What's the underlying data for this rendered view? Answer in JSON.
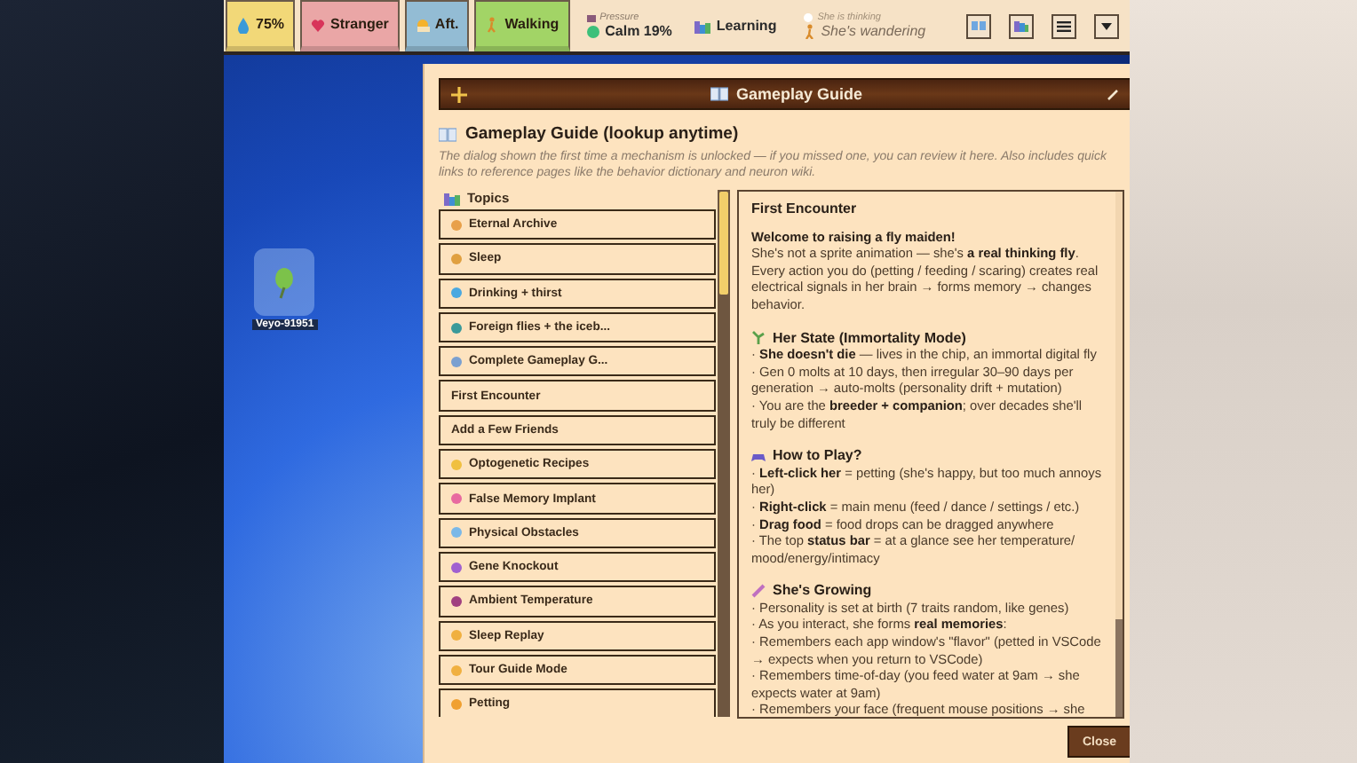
{
  "status_bar": {
    "chips": [
      {
        "label": "75%",
        "color": "#f2d878"
      },
      {
        "label": "Stranger",
        "color": "#eaa6a6"
      },
      {
        "label": "Aft.",
        "color": "#93bcd4"
      },
      {
        "label": "Walking",
        "color": "#a2d466"
      }
    ],
    "pressure": {
      "caption": "Pressure",
      "value": "Calm 19%"
    },
    "learning": "Learning",
    "thinking": {
      "caption": "She is thinking",
      "value": "She's wandering"
    }
  },
  "desktop_icon": {
    "label": "Veyo-91951"
  },
  "dialog": {
    "title": "Gameplay Guide",
    "heading": "Gameplay Guide (lookup anytime)",
    "description": "The dialog shown the first time a mechanism is unlocked — if you missed one, you can review it here. Also includes quick links to reference pages like the behavior dictionary and neuron wiki.",
    "topics_label": "Topics",
    "topics": [
      {
        "label": "Eternal Archive",
        "has_icon": true
      },
      {
        "label": "Sleep",
        "has_icon": true
      },
      {
        "label": "Drinking + thirst",
        "has_icon": true
      },
      {
        "label": "Foreign flies + the iceb...",
        "has_icon": true
      },
      {
        "label": "Complete Gameplay G...",
        "has_icon": true
      },
      {
        "label": "First Encounter",
        "has_icon": false
      },
      {
        "label": "Add a Few Friends",
        "has_icon": false
      },
      {
        "label": "Optogenetic Recipes",
        "has_icon": true
      },
      {
        "label": "False Memory Implant",
        "has_icon": true
      },
      {
        "label": "Physical Obstacles",
        "has_icon": true
      },
      {
        "label": "Gene Knockout",
        "has_icon": true
      },
      {
        "label": "Ambient Temperature",
        "has_icon": true
      },
      {
        "label": "Sleep Replay",
        "has_icon": true
      },
      {
        "label": "Tour Guide Mode",
        "has_icon": true
      },
      {
        "label": "Petting",
        "has_icon": true
      }
    ],
    "article": {
      "title": "First Encounter",
      "sections": [
        {
          "lead": "Welcome to raising a fly maiden!",
          "lines": [
            "She's not a sprite animation — she's **a real thinking fly**. Every action you do (petting / feeding / scaring) creates real electrical signals in her brain → forms memory → changes behavior."
          ]
        },
        {
          "heading": "Her State (Immortality Mode)",
          "lines": [
            "· **She doesn't die** — lives in the chip, an immortal digital fly",
            "· Gen 0 molts at 10 days, then irregular 30–90 days per generation → auto-molts (personality drift + mutation)",
            "· You are the **breeder + companion**; over decades she'll truly be different"
          ]
        },
        {
          "heading": "How to Play?",
          "lines": [
            "· **Left-click her** = petting (she's happy, but too much annoys her)",
            "· **Right-click** = main menu (feed / dance / settings / etc.)",
            "· **Drag food** = food drops can be dragged anywhere",
            "· The top **status bar** = at a glance see her temperature/ mood/energy/intimacy"
          ]
        },
        {
          "heading": "She's Growing",
          "lines": [
            "· Personality is set at birth (7 traits random, like genes)",
            "· As you interact, she forms **real memories**:",
            "· Remembers each app window's \"flavor\" (petted in VSCode → expects when you return to VSCode)",
            "· Remembers time-of-day (you feed water at 9am → she expects water at 9am)",
            "· Remembers your face (frequent mouse positions → she"
          ]
        }
      ]
    },
    "close_button": "Close"
  }
}
